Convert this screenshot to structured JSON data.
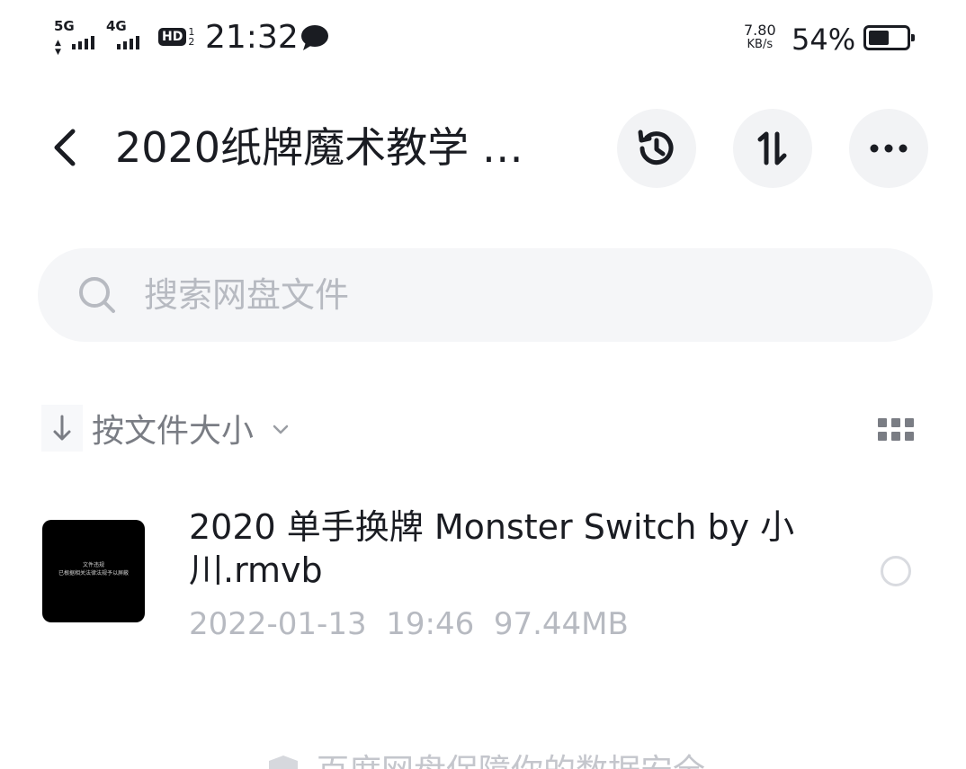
{
  "status_bar": {
    "signal_1": "5G",
    "signal_2": "4G",
    "hd_label": "HD",
    "hd_fraction_top": "1",
    "hd_fraction_bottom": "2",
    "time": "21:32",
    "net_speed_value": "7.80",
    "net_speed_unit": "KB/s",
    "battery_percent": "54%",
    "battery_level": 0.54
  },
  "header": {
    "title": "2020纸牌魔术教学 …",
    "buttons": [
      "history-icon",
      "sort-toggle-icon",
      "more-icon"
    ]
  },
  "search": {
    "placeholder": "搜索网盘文件"
  },
  "sort": {
    "label": "按文件大小"
  },
  "files": [
    {
      "name": "2020 单手换牌 Monster Switch by 小川.rmvb",
      "date": "2022-01-13",
      "time": "19:46",
      "size": "97.44MB",
      "thumbnail_text_1": "文件违规",
      "thumbnail_text_2": "已根据相关法律法规予以屏蔽"
    }
  ],
  "footer": {
    "note": "百度网盘保障你的数据安全"
  }
}
